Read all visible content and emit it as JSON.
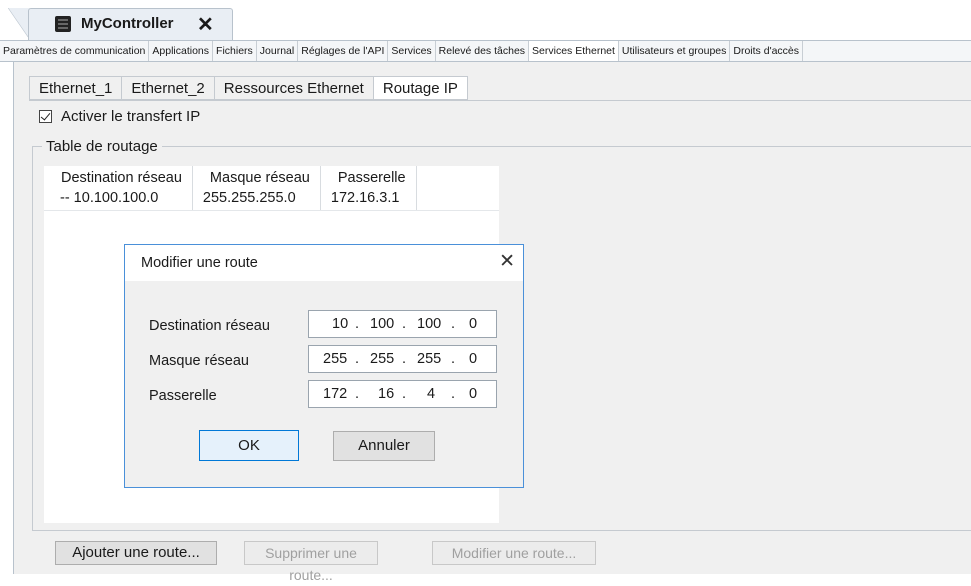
{
  "document": {
    "tab_title": "MyController",
    "close_glyph": "✕",
    "icon": "controller-icon"
  },
  "main_tabs": [
    {
      "label": "Paramètres de communication",
      "active": false
    },
    {
      "label": "Applications",
      "active": false
    },
    {
      "label": "Fichiers",
      "active": false
    },
    {
      "label": "Journal",
      "active": false
    },
    {
      "label": "Réglages de l'API",
      "active": false
    },
    {
      "label": "Services",
      "active": false
    },
    {
      "label": "Relevé des tâches",
      "active": false
    },
    {
      "label": "Services Ethernet",
      "active": true
    },
    {
      "label": "Utilisateurs et groupes",
      "active": false
    },
    {
      "label": "Droits d'accès",
      "active": false
    }
  ],
  "sub_tabs": [
    {
      "label": "Ethernet_1",
      "active": false
    },
    {
      "label": "Ethernet_2",
      "active": false
    },
    {
      "label": "Ressources Ethernet",
      "active": false
    },
    {
      "label": "Routage IP",
      "active": true
    }
  ],
  "ip_forwarding": {
    "label": "Activer le transfert IP",
    "checked": true
  },
  "routing_table": {
    "group_title": "Table de routage",
    "columns": [
      "Destination réseau",
      "Masque réseau",
      "Passerelle"
    ],
    "rows": [
      [
        "-- 10.100.100.0",
        "255.255.255.0",
        "172.16.3.1"
      ]
    ]
  },
  "dialog": {
    "title": "Modifier une route",
    "close_glyph": "✕",
    "fields": [
      {
        "label": "Destination réseau",
        "octets": [
          "10",
          "100",
          "100",
          "0"
        ]
      },
      {
        "label": "Masque réseau",
        "octets": [
          "255",
          "255",
          "255",
          "0"
        ]
      },
      {
        "label": "Passerelle",
        "octets": [
          "172",
          "16",
          "4",
          "0"
        ]
      }
    ],
    "dot": ".",
    "ok_label": "OK",
    "cancel_label": "Annuler"
  },
  "actions": {
    "add": "Ajouter une route...",
    "delete": "Supprimer une route...",
    "edit": "Modifier une route..."
  }
}
